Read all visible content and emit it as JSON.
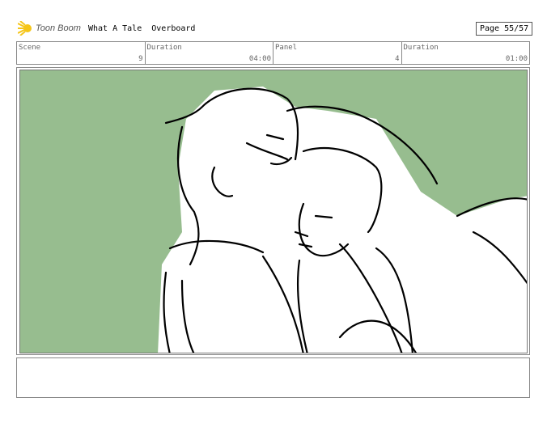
{
  "header": {
    "brand": "Toon Boom",
    "project": "What A Tale  Overboard",
    "page": "Page 55/57"
  },
  "info": [
    {
      "label": "Scene",
      "value": "9"
    },
    {
      "label": "Duration",
      "value": "04:00"
    },
    {
      "label": "Panel",
      "value": "4"
    },
    {
      "label": "Duration",
      "value": "01:00"
    }
  ],
  "panel": {
    "background_color": "#97bd8f"
  },
  "notes": {
    "text": ""
  }
}
